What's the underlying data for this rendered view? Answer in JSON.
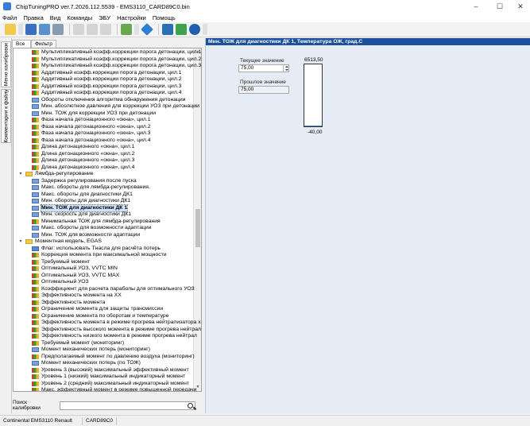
{
  "window": {
    "title": "ChipTuningPRO ver.7.2026.112.5539 - EMS3110_CARD89C0.bin",
    "controls": [
      "–",
      "☐",
      "✕"
    ]
  },
  "menu": [
    "Файл",
    "Правка",
    "Вид",
    "Команды",
    "ЭБУ",
    "Настройки",
    "Помощь"
  ],
  "vtabs": [
    "Меню калибровок",
    "Комментарии к файлу"
  ],
  "filter_tabs": [
    "Все",
    "Фильтр"
  ],
  "tree_rows": [
    {
      "label": "Мультипликативный коэфф.коррекции порога детонации, цил.1",
      "icon": "chart",
      "indent": 2
    },
    {
      "label": "Мультипликативный коэфф.коррекции порога детонации, цил.2",
      "icon": "chart",
      "indent": 2
    },
    {
      "label": "Мультипликативный коэфф.коррекции порога детонации, цил.3",
      "icon": "chart",
      "indent": 2
    },
    {
      "label": "Аддитивный коэфф.коррекции порога детонации, цил.1",
      "icon": "chart",
      "indent": 2
    },
    {
      "label": "Аддитивный коэфф.коррекции порога детонации, цил.2",
      "icon": "chart",
      "indent": 2
    },
    {
      "label": "Аддитивный коэфф.коррекции порога детонации, цил.3",
      "icon": "chart",
      "indent": 2
    },
    {
      "label": "Аддитивный коэфф.коррекции порога детонации, цил.4",
      "icon": "chart",
      "indent": 2
    },
    {
      "label": "Обороты отключения алгоритма обнаружения детонации",
      "icon": "num",
      "indent": 2
    },
    {
      "label": "Мин. абсолютное давления для коррекции УОЗ при детонации",
      "icon": "num",
      "indent": 2
    },
    {
      "label": "Мин. ТОЖ для коррекции УОЗ при детонации",
      "icon": "num",
      "indent": 2
    },
    {
      "label": "Фаза начала детонационного «окна», цил.1",
      "icon": "chart",
      "indent": 2
    },
    {
      "label": "Фаза начала детонационного «окна», цил.2",
      "icon": "chart",
      "indent": 2
    },
    {
      "label": "Фаза начала детонационного «окна», цил.3",
      "icon": "chart",
      "indent": 2
    },
    {
      "label": "Фаза начала детонационного «окна», цил.4",
      "icon": "chart",
      "indent": 2
    },
    {
      "label": "Длина детонационного «окна», цил.1",
      "icon": "chart",
      "indent": 2
    },
    {
      "label": "Длина детонационного «окна», цил.2",
      "icon": "chart",
      "indent": 2
    },
    {
      "label": "Длина детонационного «окна», цил.3",
      "icon": "chart",
      "indent": 2
    },
    {
      "label": "Длина детонационного «окна», цил.4",
      "icon": "chart",
      "indent": 2
    },
    {
      "label": "Лямбда-регулирование",
      "icon": "folder",
      "indent": 1,
      "expander": "▾"
    },
    {
      "label": "Задержка регулирования после пуска",
      "icon": "num",
      "indent": 2
    },
    {
      "label": "Макс. обороты для лямбда-регулирования.",
      "icon": "num",
      "indent": 2
    },
    {
      "label": "Макс. обороты для диагностики ДК1",
      "icon": "num",
      "indent": 2
    },
    {
      "label": "Мин. обороты для диагностики ДК1",
      "icon": "num",
      "indent": 2
    },
    {
      "label": "Мин. ТОЖ для диагностики ДК 1",
      "icon": "num",
      "indent": 2,
      "selected": true
    },
    {
      "label": "Мин. скорость для диагностики ДК1",
      "icon": "num",
      "indent": 2
    },
    {
      "label": "Минимальная ТОЖ для лямбда-регулирования",
      "icon": "chart",
      "indent": 2
    },
    {
      "label": "Макс. обороты для возможности адаптации",
      "icon": "num",
      "indent": 2
    },
    {
      "label": "Мин. ТОЖ для возможности адаптации",
      "icon": "num",
      "indent": 2
    },
    {
      "label": "Моментная модель, EGAS",
      "icon": "folder",
      "indent": 1,
      "expander": "▾"
    },
    {
      "label": "Флаг: использовать Тнасла для расчёта потерь",
      "icon": "2d",
      "indent": 2
    },
    {
      "label": "Коррекция момента при максимальной мощности",
      "icon": "chart",
      "indent": 2
    },
    {
      "label": "Требуемый момент",
      "icon": "chart",
      "indent": 2
    },
    {
      "label": "Оптимальный УОЗ, VVTC MIN",
      "icon": "chart",
      "indent": 2
    },
    {
      "label": "Оптимальный УОЗ, VVTC MAX",
      "icon": "chart",
      "indent": 2
    },
    {
      "label": "Оптимальный УОЗ",
      "icon": "chart",
      "indent": 2
    },
    {
      "label": "Коэффициент для расчета параболы для оптимального УОЗ",
      "icon": "chart",
      "indent": 2
    },
    {
      "label": "Эффективность момента на XX",
      "icon": "chart",
      "indent": 2
    },
    {
      "label": "Эффективность момента",
      "icon": "chart",
      "indent": 2
    },
    {
      "label": "Ограничение момента для защиты трансмиссии",
      "icon": "chart",
      "indent": 2
    },
    {
      "label": "Ограничение момента по оборотам и температуре",
      "icon": "chart",
      "indent": 2
    },
    {
      "label": "Эффективность момента в режиме прогрева нейтрализатора х",
      "icon": "chart",
      "indent": 2
    },
    {
      "label": "Эффективность высокого момента в режиме прогрева нейтрал",
      "icon": "chart",
      "indent": 2
    },
    {
      "label": "Эффективность низкого момента в режиме прогрева нейтрал",
      "icon": "chart",
      "indent": 2
    },
    {
      "label": "Требуемый момент (мониторинг)",
      "icon": "chart",
      "indent": 2
    },
    {
      "label": "Момент механических потерь (мониторинг)",
      "icon": "num",
      "indent": 2
    },
    {
      "label": "Предполагаемый момент по давлению воздуха (мониторинг)",
      "icon": "chart",
      "indent": 2
    },
    {
      "label": "Момент механических потерь (по ТОЖ)",
      "icon": "num",
      "indent": 2
    },
    {
      "label": "Уровень 3 (высокий) максимальный эффективный момент",
      "icon": "chart",
      "indent": 2
    },
    {
      "label": "Уровень 1 (низкий) максимальный индикаторный момент",
      "icon": "chart",
      "indent": 2
    },
    {
      "label": "Уровень 2 (средний) максимальный индикаторный момент",
      "icon": "chart",
      "indent": 2
    },
    {
      "label": "Макс. эффективный момент в режиме повышенной передачи",
      "icon": "chart",
      "indent": 2
    }
  ],
  "search": {
    "label": "Поиск калибровки",
    "value": ""
  },
  "panel": {
    "header": "Мин. ТОЖ для диагностики ДК 1, Температура ОЖ, град.С",
    "current_label": "Текущее значение",
    "current_value": "75,00",
    "previous_label": "Прошлое значение",
    "previous_value": "75,00",
    "gauge_max": "6513,50",
    "gauge_min": "-40,00",
    "gauge_fill_fraction": 0.0176
  },
  "status": [
    "Continental EMS3110 Renault",
    "CARD89C0"
  ]
}
